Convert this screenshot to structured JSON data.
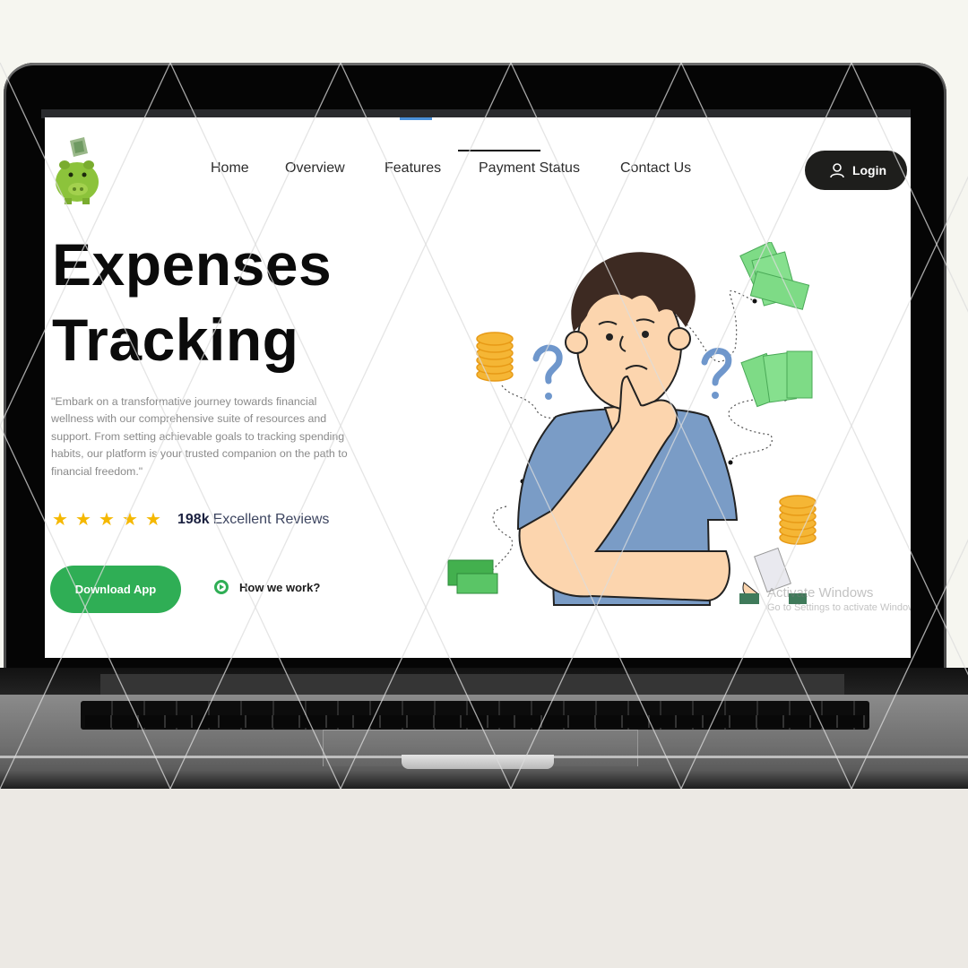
{
  "page": {
    "logo_alt": "piggy-bank-logo",
    "nav": {
      "items": [
        {
          "label": "Home"
        },
        {
          "label": "Overview"
        },
        {
          "label": "Features"
        },
        {
          "label": "Payment Status",
          "active": true
        },
        {
          "label": "Contact Us"
        }
      ],
      "login_label": "Login"
    },
    "hero": {
      "title_line1": "Expenses",
      "title_line2": "Tracking",
      "description": "\"Embark on a transformative journey towards financial wellness with our comprehensive suite of resources and support. From setting achievable goals to tracking spending habits, our platform is your trusted companion on the path to financial freedom.\"",
      "rating_stars": 5,
      "rating_max": 5,
      "reviews_count": "198k",
      "reviews_label": "Excellent Reviews",
      "download_label": "Download App",
      "how_label": "How we work?"
    },
    "watermark": {
      "line1": "Activate Windows",
      "line2": "Go to Settings to activate Windows."
    }
  },
  "colors": {
    "accent_green": "#2fae55",
    "login_bg": "#1e1e1c",
    "star": "#f5b800",
    "shirt": "#7a9cc6",
    "hair": "#3d2a22",
    "skin": "#fcd5ae",
    "cash": "#7edb86",
    "coin": "#f5b635"
  }
}
